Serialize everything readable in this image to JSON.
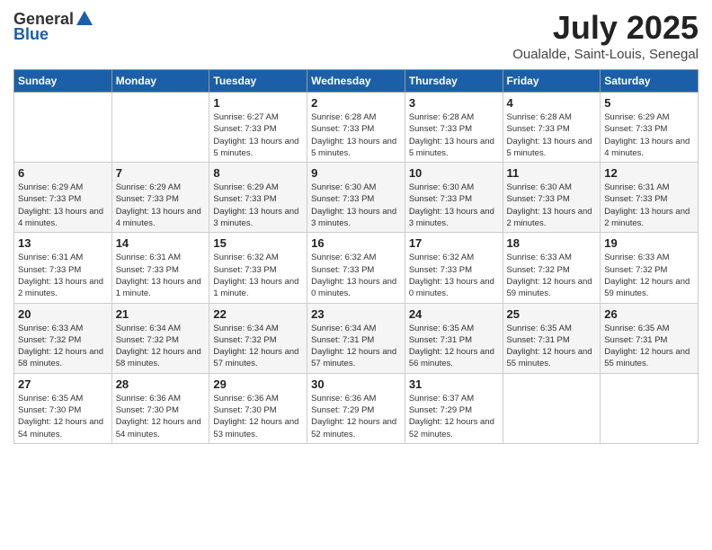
{
  "header": {
    "logo_general": "General",
    "logo_blue": "Blue",
    "month": "July 2025",
    "location": "Oualalde, Saint-Louis, Senegal"
  },
  "weekdays": [
    "Sunday",
    "Monday",
    "Tuesday",
    "Wednesday",
    "Thursday",
    "Friday",
    "Saturday"
  ],
  "weeks": [
    [
      {
        "day": "",
        "info": ""
      },
      {
        "day": "",
        "info": ""
      },
      {
        "day": "1",
        "info": "Sunrise: 6:27 AM\nSunset: 7:33 PM\nDaylight: 13 hours and 5 minutes."
      },
      {
        "day": "2",
        "info": "Sunrise: 6:28 AM\nSunset: 7:33 PM\nDaylight: 13 hours and 5 minutes."
      },
      {
        "day": "3",
        "info": "Sunrise: 6:28 AM\nSunset: 7:33 PM\nDaylight: 13 hours and 5 minutes."
      },
      {
        "day": "4",
        "info": "Sunrise: 6:28 AM\nSunset: 7:33 PM\nDaylight: 13 hours and 5 minutes."
      },
      {
        "day": "5",
        "info": "Sunrise: 6:29 AM\nSunset: 7:33 PM\nDaylight: 13 hours and 4 minutes."
      }
    ],
    [
      {
        "day": "6",
        "info": "Sunrise: 6:29 AM\nSunset: 7:33 PM\nDaylight: 13 hours and 4 minutes."
      },
      {
        "day": "7",
        "info": "Sunrise: 6:29 AM\nSunset: 7:33 PM\nDaylight: 13 hours and 4 minutes."
      },
      {
        "day": "8",
        "info": "Sunrise: 6:29 AM\nSunset: 7:33 PM\nDaylight: 13 hours and 3 minutes."
      },
      {
        "day": "9",
        "info": "Sunrise: 6:30 AM\nSunset: 7:33 PM\nDaylight: 13 hours and 3 minutes."
      },
      {
        "day": "10",
        "info": "Sunrise: 6:30 AM\nSunset: 7:33 PM\nDaylight: 13 hours and 3 minutes."
      },
      {
        "day": "11",
        "info": "Sunrise: 6:30 AM\nSunset: 7:33 PM\nDaylight: 13 hours and 2 minutes."
      },
      {
        "day": "12",
        "info": "Sunrise: 6:31 AM\nSunset: 7:33 PM\nDaylight: 13 hours and 2 minutes."
      }
    ],
    [
      {
        "day": "13",
        "info": "Sunrise: 6:31 AM\nSunset: 7:33 PM\nDaylight: 13 hours and 2 minutes."
      },
      {
        "day": "14",
        "info": "Sunrise: 6:31 AM\nSunset: 7:33 PM\nDaylight: 13 hours and 1 minute."
      },
      {
        "day": "15",
        "info": "Sunrise: 6:32 AM\nSunset: 7:33 PM\nDaylight: 13 hours and 1 minute."
      },
      {
        "day": "16",
        "info": "Sunrise: 6:32 AM\nSunset: 7:33 PM\nDaylight: 13 hours and 0 minutes."
      },
      {
        "day": "17",
        "info": "Sunrise: 6:32 AM\nSunset: 7:33 PM\nDaylight: 13 hours and 0 minutes."
      },
      {
        "day": "18",
        "info": "Sunrise: 6:33 AM\nSunset: 7:32 PM\nDaylight: 12 hours and 59 minutes."
      },
      {
        "day": "19",
        "info": "Sunrise: 6:33 AM\nSunset: 7:32 PM\nDaylight: 12 hours and 59 minutes."
      }
    ],
    [
      {
        "day": "20",
        "info": "Sunrise: 6:33 AM\nSunset: 7:32 PM\nDaylight: 12 hours and 58 minutes."
      },
      {
        "day": "21",
        "info": "Sunrise: 6:34 AM\nSunset: 7:32 PM\nDaylight: 12 hours and 58 minutes."
      },
      {
        "day": "22",
        "info": "Sunrise: 6:34 AM\nSunset: 7:32 PM\nDaylight: 12 hours and 57 minutes."
      },
      {
        "day": "23",
        "info": "Sunrise: 6:34 AM\nSunset: 7:31 PM\nDaylight: 12 hours and 57 minutes."
      },
      {
        "day": "24",
        "info": "Sunrise: 6:35 AM\nSunset: 7:31 PM\nDaylight: 12 hours and 56 minutes."
      },
      {
        "day": "25",
        "info": "Sunrise: 6:35 AM\nSunset: 7:31 PM\nDaylight: 12 hours and 55 minutes."
      },
      {
        "day": "26",
        "info": "Sunrise: 6:35 AM\nSunset: 7:31 PM\nDaylight: 12 hours and 55 minutes."
      }
    ],
    [
      {
        "day": "27",
        "info": "Sunrise: 6:35 AM\nSunset: 7:30 PM\nDaylight: 12 hours and 54 minutes."
      },
      {
        "day": "28",
        "info": "Sunrise: 6:36 AM\nSunset: 7:30 PM\nDaylight: 12 hours and 54 minutes."
      },
      {
        "day": "29",
        "info": "Sunrise: 6:36 AM\nSunset: 7:30 PM\nDaylight: 12 hours and 53 minutes."
      },
      {
        "day": "30",
        "info": "Sunrise: 6:36 AM\nSunset: 7:29 PM\nDaylight: 12 hours and 52 minutes."
      },
      {
        "day": "31",
        "info": "Sunrise: 6:37 AM\nSunset: 7:29 PM\nDaylight: 12 hours and 52 minutes."
      },
      {
        "day": "",
        "info": ""
      },
      {
        "day": "",
        "info": ""
      }
    ]
  ]
}
